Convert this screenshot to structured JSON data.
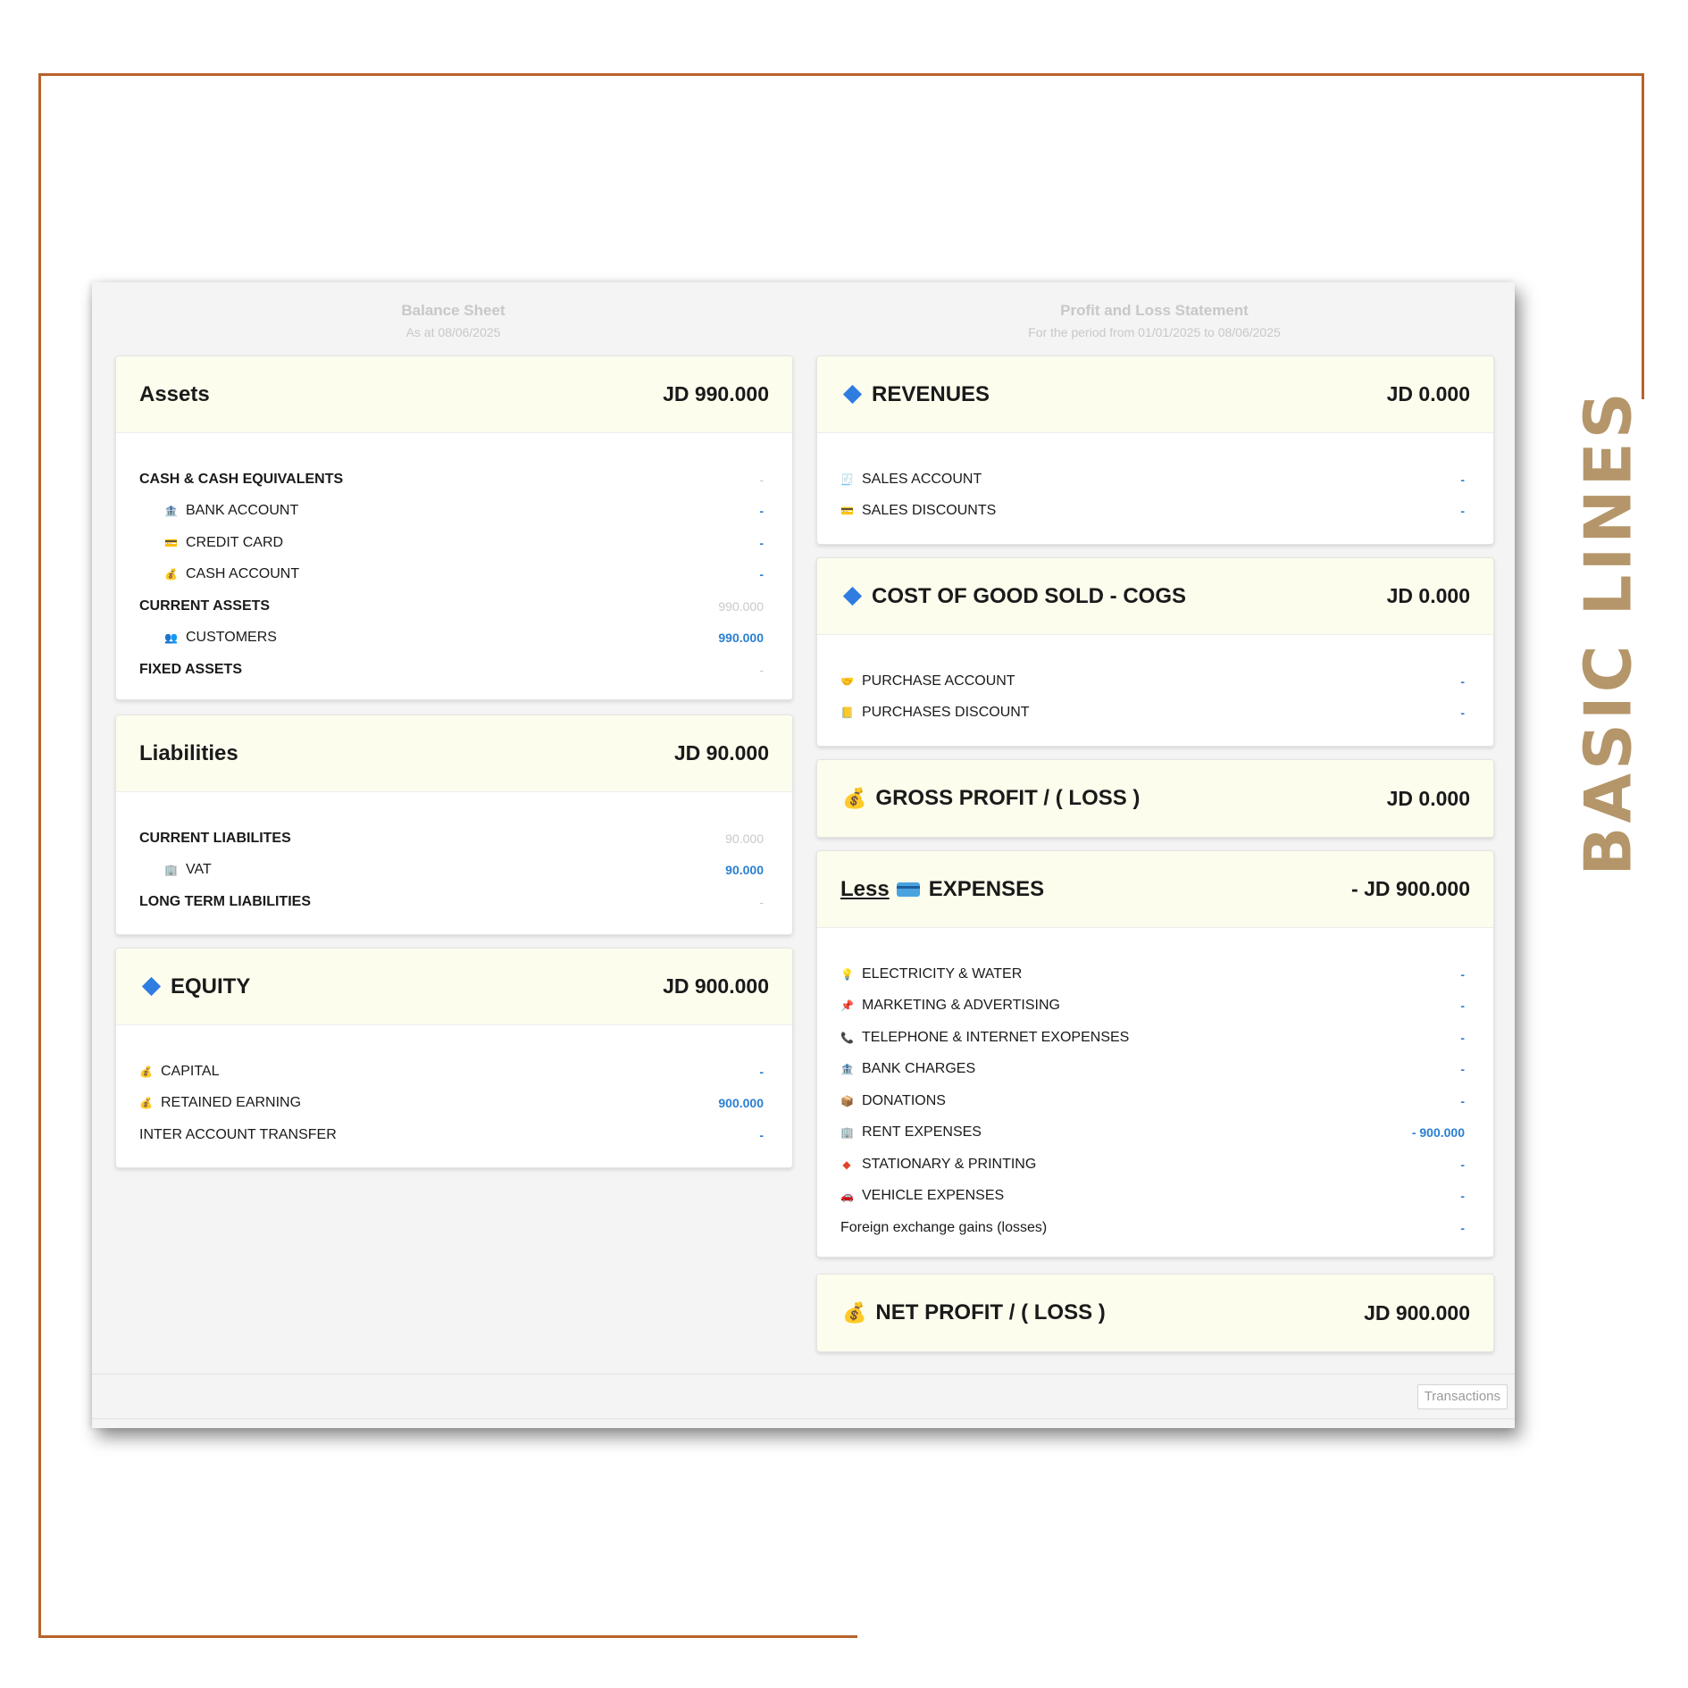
{
  "side_title": "BASIC LINES",
  "balance_sheet": {
    "title": "Balance Sheet",
    "subtitle": "As at 08/06/2025",
    "assets": {
      "title": "Assets",
      "amount": "JD 990.000",
      "rows": [
        {
          "label": "CASH & CASH EQUIVALENTS",
          "value": "-",
          "icon": "none"
        },
        {
          "label": "BANK ACCOUNT",
          "value": "-",
          "icon": "bank-icon"
        },
        {
          "label": "CREDIT CARD",
          "value": "-",
          "icon": "credit-card-icon"
        },
        {
          "label": "CASH ACCOUNT",
          "value": "-",
          "icon": "money-bag-icon"
        },
        {
          "label": "CURRENT ASSETS",
          "value": "990.000",
          "icon": "none"
        },
        {
          "label": "CUSTOMERS",
          "value": "990.000",
          "icon": "people-icon"
        },
        {
          "label": "FIXED ASSETS",
          "value": "-",
          "icon": "none"
        }
      ]
    },
    "liabilities": {
      "title": "Liabilities",
      "amount": "JD 90.000",
      "rows": [
        {
          "label": "CURRENT LIABILITES",
          "value": "90.000",
          "icon": "none"
        },
        {
          "label": "VAT",
          "value": "90.000",
          "icon": "building-icon"
        },
        {
          "label": "LONG TERM LIABILITIES",
          "value": "-",
          "icon": "none"
        }
      ]
    },
    "equity": {
      "title": "EQUITY",
      "amount": "JD 900.000",
      "rows": [
        {
          "label": "CAPITAL",
          "value": "-",
          "icon": "money-bag-icon"
        },
        {
          "label": "RETAINED EARNING",
          "value": "900.000",
          "icon": "money-bag-icon"
        },
        {
          "label": "INTER ACCOUNT TRANSFER",
          "value": "-",
          "icon": "none"
        }
      ]
    }
  },
  "profit_loss": {
    "title": "Profit and Loss Statement",
    "subtitle": "For the period from 01/01/2025 to 08/06/2025",
    "revenues": {
      "title": "REVENUES",
      "amount": "JD 0.000",
      "rows": [
        {
          "label": "SALES ACCOUNT",
          "value": "-",
          "icon": "receipt-icon"
        },
        {
          "label": "SALES DISCOUNTS",
          "value": "-",
          "icon": "credit-card-icon"
        }
      ]
    },
    "cogs": {
      "title": "COST OF GOOD SOLD - COGS",
      "amount": "JD 0.000",
      "rows": [
        {
          "label": "PURCHASE ACCOUNT",
          "value": "-",
          "icon": "handshake-icon"
        },
        {
          "label": "PURCHASES DISCOUNT",
          "value": "-",
          "icon": "ledger-icon"
        }
      ]
    },
    "gross_profit": {
      "title": "GROSS PROFIT / ( LOSS )",
      "amount": "JD 0.000"
    },
    "expenses": {
      "prefix": "Less",
      "title": "EXPENSES",
      "amount": "- JD 900.000",
      "rows": [
        {
          "label": "ELECTRICITY & WATER",
          "value": "-",
          "icon": "light-bulb-icon"
        },
        {
          "label": "MARKETING & ADVERTISING",
          "value": "-",
          "icon": "pin-icon"
        },
        {
          "label": "TELEPHONE & INTERNET EXOPENSES",
          "value": "-",
          "icon": "phone-icon"
        },
        {
          "label": "BANK CHARGES",
          "value": "-",
          "icon": "bank-icon"
        },
        {
          "label": "DONATIONS",
          "value": "-",
          "icon": "box-icon"
        },
        {
          "label": "RENT EXPENSES",
          "value": "- 900.000",
          "icon": "building-icon"
        },
        {
          "label": "STATIONARY & PRINTING",
          "value": "-",
          "icon": "diamond-small-icon"
        },
        {
          "label": "VEHICLE EXPENSES",
          "value": "-",
          "icon": "car-icon"
        },
        {
          "label": "Foreign exchange gains (losses)",
          "value": "-",
          "icon": "none"
        }
      ]
    },
    "net_profit": {
      "title": "NET PROFIT / ( LOSS )",
      "amount": "JD 900.000"
    }
  },
  "footer": {
    "transactions_button": "Transactions"
  },
  "colors": {
    "accent": "#2f7de1",
    "value_blue": "#2a7fd2",
    "frame": "#b8622a",
    "card_header": "#fdfdee"
  }
}
